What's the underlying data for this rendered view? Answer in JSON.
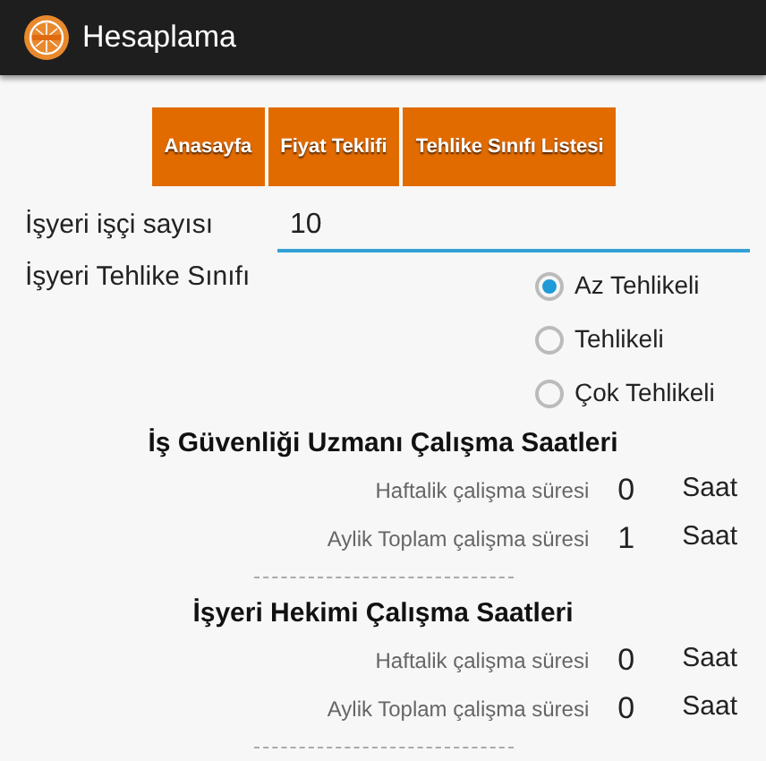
{
  "app_bar": {
    "title": "Hesaplama"
  },
  "nav_buttons": [
    "Anasayfa",
    "Fiyat Teklifi",
    "Tehlike Sınıfı Listesi"
  ],
  "worker_count": {
    "label": "İşyeri işçi sayısı",
    "value": "10"
  },
  "hazard_class": {
    "label": "İşyeri Tehlike Sınıfı",
    "options": [
      {
        "label": "Az Tehlikeli",
        "selected": true
      },
      {
        "label": "Tehlikeli",
        "selected": false
      },
      {
        "label": "Çok Tehlikeli",
        "selected": false
      }
    ]
  },
  "sections": [
    {
      "title": "İş Güvenliği Uzmanı Çalışma Saatleri",
      "rows": [
        {
          "label": "Haftalik çalişma süresi",
          "value": "0",
          "unit": "Saat"
        },
        {
          "label": "Aylik Toplam çalişma süresi",
          "value": "1",
          "unit": "Saat"
        }
      ]
    },
    {
      "title": "İşyeri Hekimi Çalışma Saatleri",
      "rows": [
        {
          "label": "Haftalik çalişma süresi",
          "value": "0",
          "unit": "Saat"
        },
        {
          "label": "Aylik Toplam çalişma süresi",
          "value": "0",
          "unit": "Saat"
        }
      ]
    }
  ]
}
